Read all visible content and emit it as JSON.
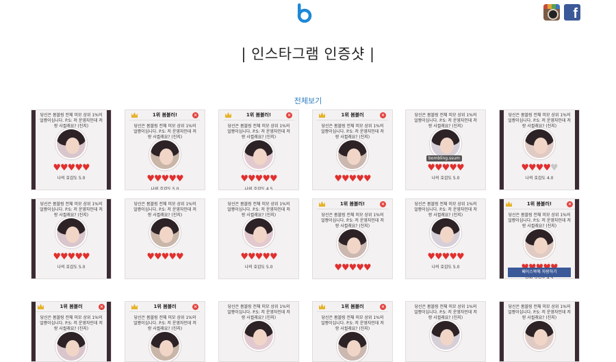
{
  "header": {
    "logo_icon": "b-logo-icon",
    "social": [
      {
        "name": "instagram",
        "icon": "instagram-icon"
      },
      {
        "name": "facebook",
        "icon": "facebook-icon"
      }
    ]
  },
  "page": {
    "title": "| 인스타그램 인증샷 |",
    "view_all": "전체보기"
  },
  "cards": [
    {
      "variant": "plain",
      "text": "당신은 봄블링 전체 미모 상위 1%의 얼짱이십니다. P.S: 저 운영자인데 저랑 사귈래요? (진지)",
      "hearts": 5,
      "score": "나의 호감도 5.0"
    },
    {
      "variant": "header",
      "header": "1위 봄블러!",
      "text": "당신은 봄블링 전체 미모 상위 1%의 얼짱이십니다. P.S: 저 운영자인데 저랑 사귈래요? (진지)",
      "hearts": 5,
      "score": "나의 호감도 5.0"
    },
    {
      "variant": "header",
      "header": "1위 봄블러!",
      "text": "당신은 봄블링 전체 미모 상위 1%의 얼짱이십니다. P.S: 저 운영자인데 저랑 사귈래요? (진지)",
      "hearts": 5,
      "score": "나의 호감도 4.5"
    },
    {
      "variant": "header",
      "header": "1위 봄블러",
      "text": "당신은 봄블링 전체 미모 상위 1%의 얼짱이십니다. P.S: 저 운영자인데 저랑 사귈래요? (진지)",
      "hearts": 5,
      "score": ""
    },
    {
      "variant": "plain",
      "text": "당신은 봄블링 전체 미모 상위 1%의 얼짱이십니다. P.S: 저 운영자인데 저랑 사귈래요? (진지)",
      "hearts": 5,
      "score": "나의 호감도 5.0",
      "tag": "bombling.ssum"
    },
    {
      "variant": "plain",
      "text": "당신은 봄블링 전체 미모 상위 1%의 얼짱이십니다. P.S: 저 운영자인데 저랑 사귈래요? (진지)",
      "hearts": 4,
      "score": "나의 호감도 4.0"
    },
    {
      "variant": "plain",
      "text": "당신은 봄블링 전체 미모 상위 1%의 얼짱이십니다. P.S: 저 운영자인데 저랑 사귈래요? (진지)",
      "hearts": 5,
      "score": "나의 호감도 5.0"
    },
    {
      "variant": "plain",
      "text": "당신은 봄블링 전체 미모 상위 1%의 얼짱이십니다. P.S: 저 운영자인데 저랑 사귈래요? (진지)",
      "hearts": 5,
      "score": ""
    },
    {
      "variant": "plain",
      "text": "당신은 봄블링 전체 미모 상위 1%의 얼짱이십니다. P.S: 저 운영자인데 저랑 사귈래요? (진지)",
      "hearts": 5,
      "score": "나의 호감도 5.0"
    },
    {
      "variant": "header",
      "header": "1위 봄블러!",
      "text": "당신은 봄블링 전체 미모 상위 1%의 얼짱이십니다. P.S: 저 운영자인데 저랑 사귈래요? (진지)",
      "hearts": 5,
      "score": ""
    },
    {
      "variant": "plain",
      "text": "당신은 봄블링 전체 미모 상위 1%의 얼짱이십니다. P.S: 저 운영자인데 저랑 사귈래요? (진지)",
      "hearts": 5,
      "score": "나의 호감도 5.0"
    },
    {
      "variant": "header",
      "header": "1위 봄블러!",
      "text": "당신은 봄블링 전체 미모 상위 1%의 얼짱이십니다. P.S: 저 운영자인데 저랑 사귈래요? (진지)",
      "hearts": 5,
      "score": "나의 호감도 4.5",
      "fbbar": "페이스북에 자랑하기"
    },
    {
      "variant": "header",
      "header": "1위 봄블러",
      "text": "당신은 봄블링 전체 미모 상위 1%의 얼짱이십니다. P.S: 저 운영자인데 저랑 사귈래요? (진지)",
      "hearts": 0,
      "score": ""
    },
    {
      "variant": "header",
      "header": "1위 봄블러",
      "text": "당신은 봄블링 전체 미모 상위 1%의 얼짱이십니다. P.S: 저 운영자인데 저랑 사귈래요? (진지)",
      "hearts": 0,
      "score": ""
    },
    {
      "variant": "plain",
      "text": "당신은 봄블링 전체 미모 상위 1%의 얼짱이십니다. P.S: 저 운영자인데 저랑 사귈래요? (진지)",
      "hearts": 0,
      "score": ""
    },
    {
      "variant": "header",
      "header": "1위 봄블러",
      "text": "당신은 봄블링 전체 미모 상위 1%의 얼짱이십니다. P.S: 저 운영자인데 저랑 사귈래요? (진지)",
      "hearts": 0,
      "score": ""
    },
    {
      "variant": "plain",
      "text": "당신은 봄블링 전체 미모 상위 1%의 얼짱이십니다. P.S: 저 운영자인데 저랑 사귈래요? (진지)",
      "hearts": 0,
      "score": ""
    },
    {
      "variant": "plain",
      "text": "당신은 봄블링 전체 미모 상위 1%의 얼짱이십니다. P.S: 저 운영자인데 저랑 사귈래요? (진지)",
      "hearts": 0,
      "score": ""
    }
  ]
}
